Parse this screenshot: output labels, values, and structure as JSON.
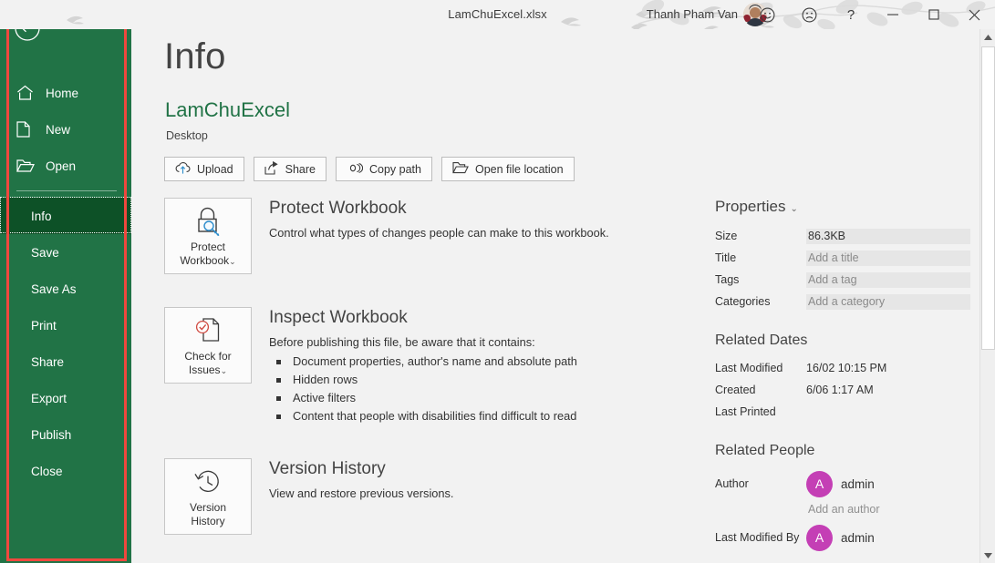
{
  "titlebar": {
    "document_title": "LamChuExcel.xlsx",
    "user_name": "Thanh Pham Van",
    "icons": {
      "avatar": "user-avatar",
      "feedback_smile": "smiley-face-icon",
      "feedback_frown": "frowny-face-icon",
      "help": "?",
      "minimize": "minimize-icon",
      "maximize": "maximize-icon",
      "close": "close-icon"
    }
  },
  "nav": {
    "back_label": "Back",
    "items": [
      {
        "label": "Home",
        "icon": "home-icon",
        "selected": false
      },
      {
        "label": "New",
        "icon": "new-document-icon",
        "selected": false
      },
      {
        "label": "Open",
        "icon": "open-folder-icon",
        "selected": false
      }
    ],
    "items2": [
      {
        "label": "Info",
        "selected": true
      },
      {
        "label": "Save",
        "selected": false
      },
      {
        "label": "Save As",
        "selected": false
      },
      {
        "label": "Print",
        "selected": false
      },
      {
        "label": "Share",
        "selected": false
      },
      {
        "label": "Export",
        "selected": false
      },
      {
        "label": "Publish",
        "selected": false
      },
      {
        "label": "Close",
        "selected": false
      }
    ]
  },
  "header": {
    "page_title": "Info",
    "file_name": "LamChuExcel",
    "file_location": "Desktop"
  },
  "actions": [
    {
      "label": "Upload",
      "icon": "cloud-upload-icon"
    },
    {
      "label": "Share",
      "icon": "share-icon"
    },
    {
      "label": "Copy path",
      "icon": "link-icon"
    },
    {
      "label": "Open file location",
      "icon": "folder-open-icon"
    }
  ],
  "sections": {
    "protect": {
      "tile_line1": "Protect",
      "tile_line2": "Workbook",
      "tile_caret": "⌄",
      "icon": "lock-with-key-icon",
      "title": "Protect Workbook",
      "description": "Control what types of changes people can make to this workbook."
    },
    "inspect": {
      "tile_line1": "Check for",
      "tile_line2": "Issues",
      "tile_caret": "⌄",
      "icon": "document-check-icon",
      "title": "Inspect Workbook",
      "description": "Before publishing this file, be aware that it contains:",
      "bullets": [
        "Document properties, author's name and absolute path",
        "Hidden rows",
        "Active filters",
        "Content that people with disabilities find difficult to read"
      ]
    },
    "version": {
      "tile_line1": "Version",
      "tile_line2": "History",
      "icon": "clock-history-icon",
      "title": "Version History",
      "description": "View and restore previous versions."
    }
  },
  "properties": {
    "heading": "Properties",
    "caret": "⌄",
    "rows": [
      {
        "key": "Size",
        "value": "86.3KB",
        "placeholder": false
      },
      {
        "key": "Title",
        "value": "Add a title",
        "placeholder": true
      },
      {
        "key": "Tags",
        "value": "Add a tag",
        "placeholder": true
      },
      {
        "key": "Categories",
        "value": "Add a category",
        "placeholder": true
      }
    ]
  },
  "related_dates": {
    "heading": "Related Dates",
    "rows": [
      {
        "key": "Last Modified",
        "value": "16/02 10:15 PM"
      },
      {
        "key": "Created",
        "value": "6/06 1:17 AM"
      },
      {
        "key": "Last Printed",
        "value": ""
      }
    ]
  },
  "related_people": {
    "heading": "Related People",
    "author_key": "Author",
    "author_initial": "A",
    "author_name": "admin",
    "add_author": "Add an author",
    "modified_by_key": "Last Modified By",
    "modified_by_initial": "A",
    "modified_by_name": "admin"
  },
  "colors": {
    "excel_green": "#217346",
    "selected_green": "#0d5127",
    "annotation_red": "#f0483e",
    "avatar_magenta": "#c43fb5",
    "accent_blue": "#2b8ccc",
    "check_red": "#d04a41",
    "content_bg": "#f2f2f2"
  }
}
